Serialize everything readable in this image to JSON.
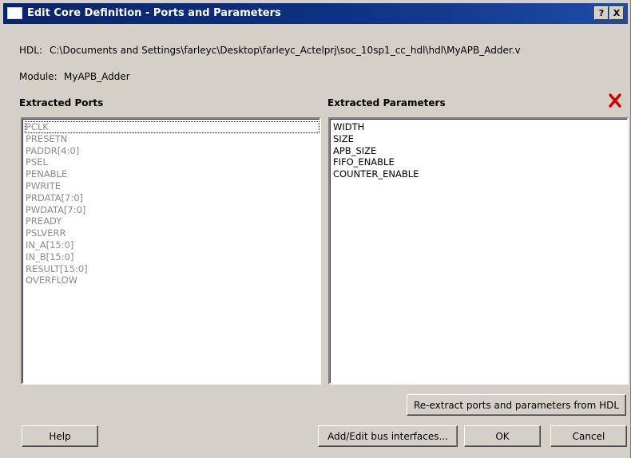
{
  "window": {
    "title": "Edit Core Definition - Ports and Parameters",
    "help_button": "?",
    "close_button": "X"
  },
  "hdl": {
    "label": "HDL:",
    "path": "C:\\Documents and Settings\\farleyc\\Desktop\\farleyc_Actelprj\\soc_10sp1_cc_hdl\\hdl\\MyAPB_Adder.v"
  },
  "module": {
    "label": "Module:",
    "name": "MyAPB_Adder"
  },
  "ports": {
    "header": "Extracted Ports",
    "items": [
      "PCLK",
      "PRESETN",
      "PADDR[4:0]",
      "PSEL",
      "PENABLE",
      "PWRITE",
      "PRDATA[7:0]",
      "PWDATA[7:0]",
      "PREADY",
      "PSLVERR",
      "IN_A[15:0]",
      "IN_B[15:0]",
      "RESULT[15:0]",
      "OVERFLOW"
    ]
  },
  "parameters": {
    "header": "Extracted Parameters",
    "items": [
      "WIDTH",
      "SIZE",
      "APB_SIZE",
      "FIFO_ENABLE",
      "COUNTER_ENABLE"
    ]
  },
  "buttons": {
    "reextract": "Re-extract ports and parameters from HDL",
    "help": "Help",
    "add_edit_bus": "Add/Edit bus interfaces...",
    "ok": "OK",
    "cancel": "Cancel"
  },
  "icons": {
    "delete": "red-x-delete-icon",
    "app": "window-app-icon"
  },
  "colors": {
    "titlebar": "#0a246a",
    "dialog_bg": "#d4d0c8",
    "disabled_text": "#8c8c8c",
    "delete_icon": "#cc0000"
  }
}
